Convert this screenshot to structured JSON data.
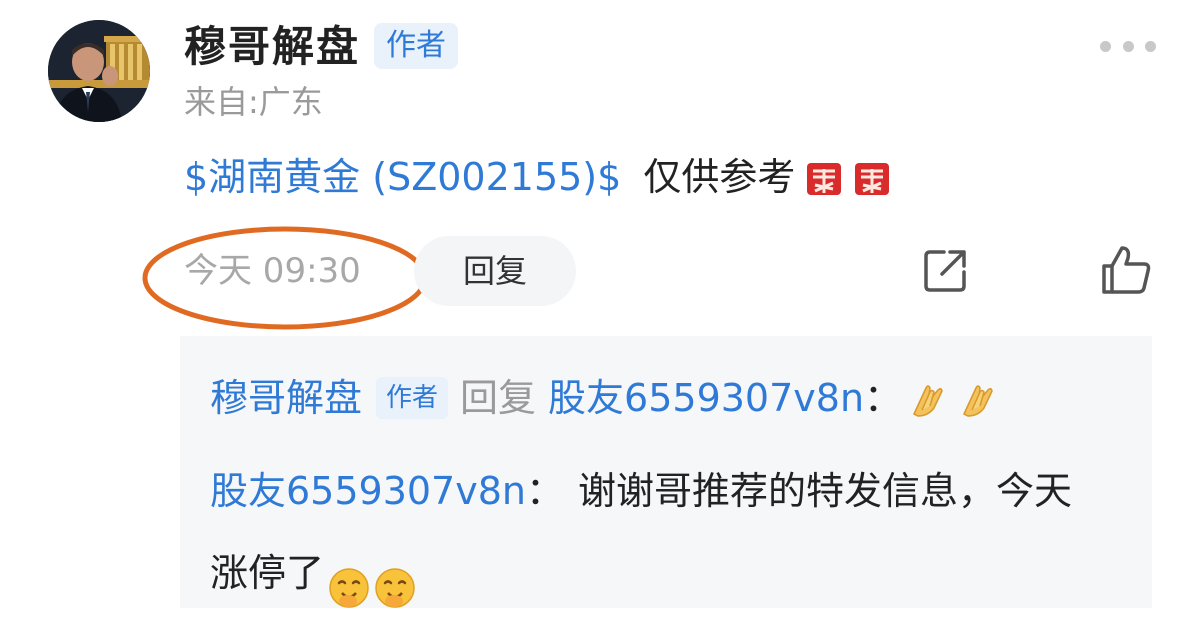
{
  "comment": {
    "author": "穆哥解盘",
    "author_badge": "作者",
    "location": "来自:广东",
    "stock_link": "$湖南黄金 (SZ002155)$",
    "text": "仅供参考",
    "emoji": [
      "buy-emoji",
      "buy-emoji"
    ],
    "timestamp": "今天 09:30",
    "reply_button": "回复",
    "actions": [
      "more-icon",
      "share-icon",
      "like-icon"
    ]
  },
  "replies": [
    {
      "author": "穆哥解盘",
      "badge": "作者",
      "reply_word": "回复",
      "target": "股友6559307v8n",
      "colon": "：",
      "emoji": [
        "clap-hands-emoji",
        "clap-hands-emoji"
      ]
    },
    {
      "author": "股友6559307v8n",
      "colon": "：",
      "text": "谢谢哥推荐的特发信息，今天涨停了",
      "emoji": [
        "smiling-face-emoji",
        "smiling-face-emoji"
      ]
    }
  ],
  "colors": {
    "link": "#2f7ad6",
    "badge_bg": "#e9f1fb",
    "annotation": "#e06a22",
    "reply_bg": "#f6f7f9"
  }
}
